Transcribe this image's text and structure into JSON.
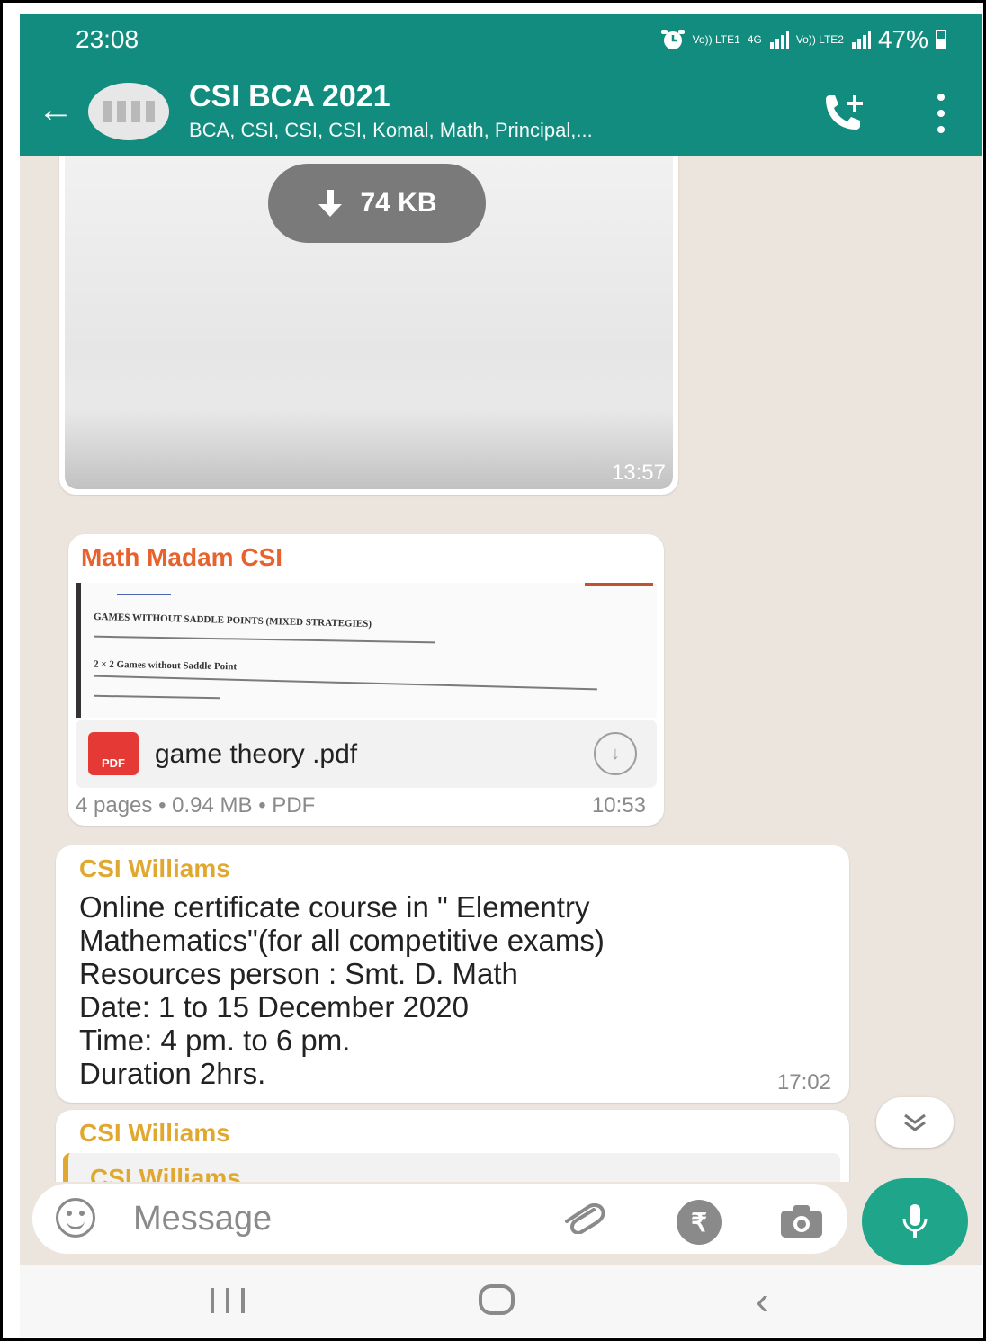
{
  "status_bar": {
    "time": "23:08",
    "signal_1": "Vo)) LTE1",
    "network": "4G",
    "signal_2": "Vo)) LTE2",
    "battery": "47%"
  },
  "header": {
    "title": "CSI BCA 2021",
    "subtitle": "BCA, CSI, CSI, CSI, Komal, Math, Principal,..."
  },
  "messages": {
    "image_message": {
      "download_size": "74 KB",
      "time": "13:57"
    },
    "document_message": {
      "sender": "Math Madam CSI",
      "preview_lines": [
        "GAMES WITHOUT SADDLE POINTS (MIXED STRATEGIES)",
        "2 × 2 Games without Saddle Point"
      ],
      "file_type_badge": "PDF",
      "file_name": "game theory .pdf",
      "meta": "4 pages • 0.94 MB • PDF",
      "time": "10:53"
    },
    "text_message": {
      "sender": "CSI Williams",
      "lines": [
        "Online certificate course in \" Elementry",
        "Mathematics\"(for all competitive exams)",
        "Resources person : Smt. D. Math",
        "Date: 1 to 15 December 2020",
        "Time: 4 pm. to 6 pm.",
        "Duration 2hrs."
      ],
      "time": "17:02"
    },
    "reply_message": {
      "sender": "CSI Williams",
      "quoted_sender": "CSI Williams"
    }
  },
  "composer": {
    "placeholder": "Message",
    "currency_symbol": "₹"
  },
  "colors": {
    "header": "#128c7e",
    "chat_background": "#ece5dd",
    "mic_button": "#1fa589",
    "sender_orange": "#e8622d",
    "sender_gold": "#e0a82e",
    "pdf_red": "#e53935"
  },
  "icons": [
    "back-arrow-icon",
    "group-avatar",
    "add-call-icon",
    "more-options-icon",
    "download-icon",
    "pdf-icon",
    "emoji-icon",
    "attach-icon",
    "rupee-payment-icon",
    "camera-icon",
    "mic-icon",
    "scroll-down-icon",
    "nav-recents-icon",
    "nav-home-icon",
    "nav-back-icon"
  ]
}
